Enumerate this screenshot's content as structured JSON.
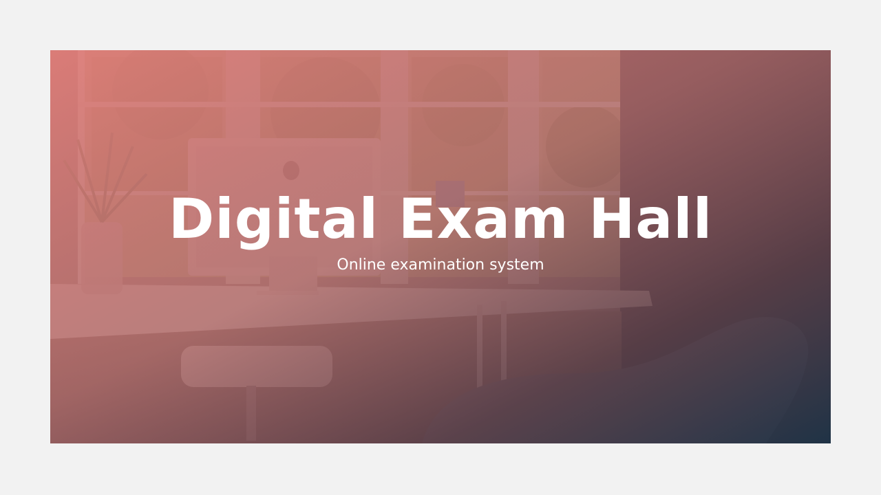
{
  "slide": {
    "title": "Digital Exam Hall",
    "subtitle": "Online examination system",
    "background": "office-photo",
    "colors": {
      "page": "#f2f2f2",
      "gradient_start": "#e07c78",
      "gradient_end": "#1e3347",
      "text": "#ffffff"
    }
  }
}
